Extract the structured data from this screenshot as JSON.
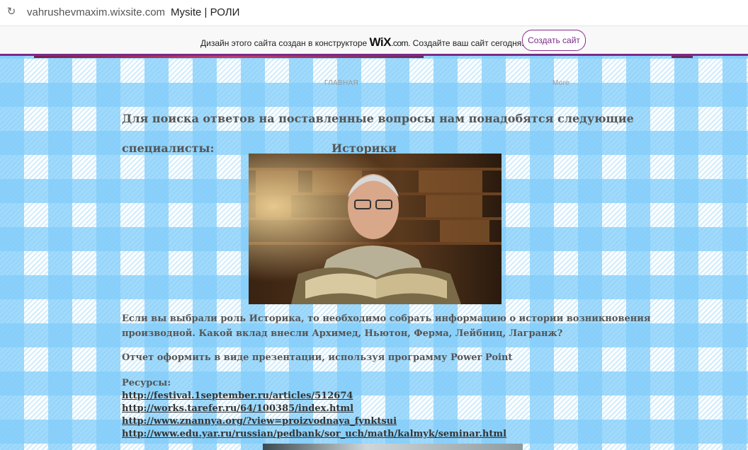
{
  "browser": {
    "url": "vahrushevmaxim.wixsite.com",
    "page_title": "Mysite | РОЛИ"
  },
  "wix_banner": {
    "message_before": "Дизайн этого сайта создан в конструкторе ",
    "logo": "WiX",
    "logo_domain": ".com",
    "message_after": ". Создайте ваш сайт сегодня.",
    "cta_label": "Создать сайт"
  },
  "nav": {
    "home": "ГЛАВНАЯ",
    "more": "More"
  },
  "content": {
    "intro_line1": "Для поиска ответов на поставленные вопросы нам понадобятся следующие",
    "intro_line2": "специалисты:",
    "role": "Историки",
    "body1": " Если вы выбрали роль Историка, то необходимо собрать информацию о истории возникновения производной. Какой вклад внесли Архимед, Ньютон, Ферма, Лейбниц, Лагранж?",
    "body2": "Отчет оформить в виде презентации, используя программу Power Point",
    "resources_label": "Ресурсы:",
    "links": [
      "http://festival.1september.ru/articles/512674",
      "http://works.tarefer.ru/64/100385/index.html",
      "http://www.znannya.org/?view=proizvodnaya_fynktsui",
      "http://www.edu.yar.ru/russian/pedbank/sor_uch/math/kalmyk/seminar.html"
    ]
  },
  "colors": {
    "accent": "#7c2a8a",
    "check": "#82cdfa"
  }
}
